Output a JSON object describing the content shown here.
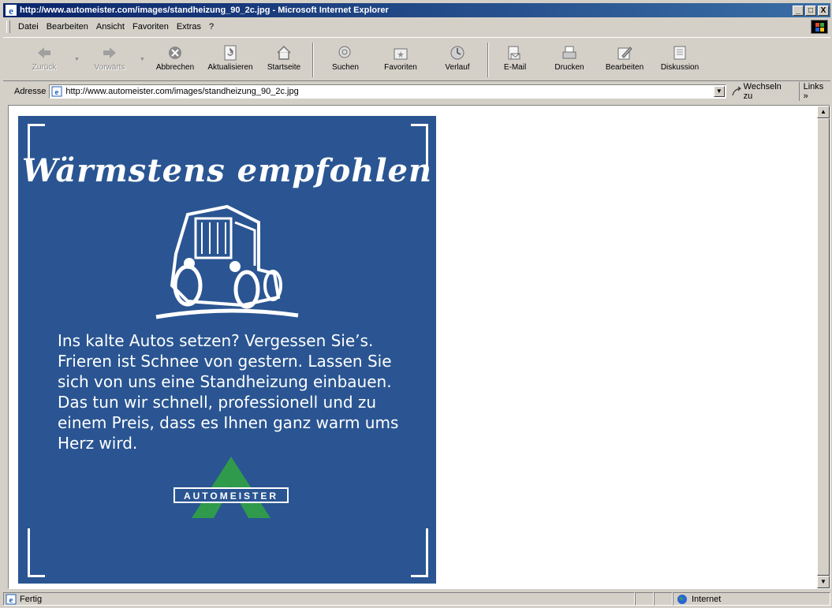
{
  "window": {
    "title": "http://www.automeister.com/images/standheizung_90_2c.jpg - Microsoft Internet Explorer",
    "controls": [
      "_",
      "□",
      "X"
    ]
  },
  "menu": [
    {
      "label": "Datei"
    },
    {
      "label": "Bearbeiten"
    },
    {
      "label": "Ansicht"
    },
    {
      "label": "Favoriten"
    },
    {
      "label": "Extras"
    },
    {
      "label": "?"
    }
  ],
  "toolbar": {
    "back": "Zurück",
    "forward": "Vorwärts",
    "stop": "Abbrechen",
    "refresh": "Aktualisieren",
    "home": "Startseite",
    "search": "Suchen",
    "favorites": "Favoriten",
    "history": "Verlauf",
    "mail": "E-Mail",
    "print": "Drucken",
    "edit": "Bearbeiten",
    "discuss": "Diskussion"
  },
  "address": {
    "label": "Adresse",
    "url": "http://www.automeister.com/images/standheizung_90_2c.jpg",
    "go": "Wechseln zu",
    "links": "Links »"
  },
  "ad": {
    "headline": "Wärmstens empfohlen",
    "body": "Ins kalte Autos setzen? Vergessen Sie’s. Frieren ist Schnee von gestern. Lassen Sie sich von uns eine Standheizung einbauen. Das tun wir schnell, professionell und zu einem Preis, dass es Ihnen ganz warm ums Herz wird.",
    "logo_text": "AUTOMEISTER",
    "colors": {
      "background": "#2a5592",
      "logo_green": "#2f9a4c"
    }
  },
  "status": {
    "text": "Fertig",
    "zone": "Internet"
  }
}
